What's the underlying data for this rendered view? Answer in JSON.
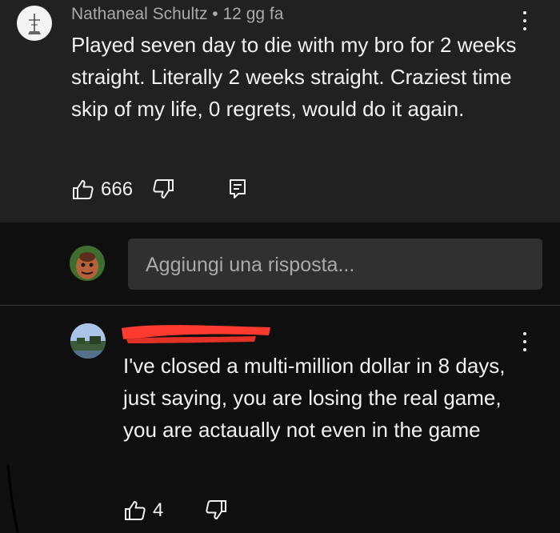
{
  "top_comment": {
    "author": "Nathaneal Schultz",
    "separator": "•",
    "time": "12 gg fa",
    "text": "Played seven day to die with my bro for 2 weeks straight. Literally 2 weeks straight. Craziest time skip of my life, 0 regrets, would do it again.",
    "likes": "666",
    "icons": [
      "thumbs-up-icon",
      "thumbs-down-icon",
      "reply-icon",
      "more-vert-icon"
    ]
  },
  "reply_input": {
    "placeholder": "Aggiungi una risposta..."
  },
  "reply_comment": {
    "text": "I've closed a multi-million dollar in 8 days, just saying, you are losing the real game, you are actaually not even in the game",
    "likes": "4",
    "icons": [
      "thumbs-up-icon",
      "thumbs-down-icon",
      "more-vert-icon"
    ]
  },
  "colors": {
    "background": "#0f0f0f",
    "card": "#212121",
    "input": "#303030",
    "meta_text": "#aaaaaa",
    "redaction": "#ff3b2f"
  }
}
